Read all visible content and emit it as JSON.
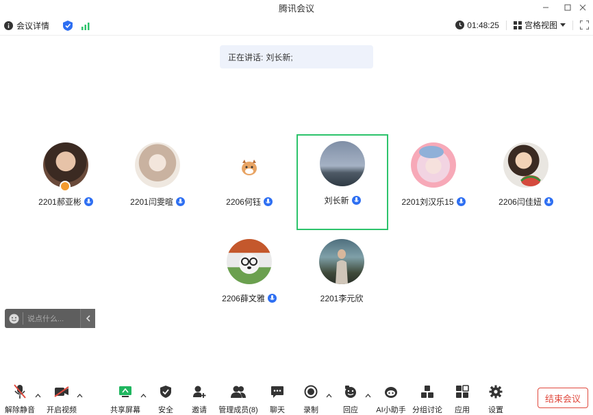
{
  "window": {
    "title": "腾讯会议"
  },
  "infobar": {
    "meeting_info": "会议详情",
    "timer": "01:48:25",
    "view_mode": "宫格视图"
  },
  "speaking": {
    "label": "正在讲话:",
    "names": "刘长新;"
  },
  "participants": [
    {
      "name": "2201郝亚彬"
    },
    {
      "name": "2201闫雯暄"
    },
    {
      "name": "2206何钰"
    },
    {
      "name": "刘长新"
    },
    {
      "name": "2201刘汉乐15"
    },
    {
      "name": "2206闫佳妞"
    },
    {
      "name": "2206薛文雅"
    },
    {
      "name": "2201李元欣"
    }
  ],
  "chat": {
    "placeholder": "说点什么..."
  },
  "toolbar": {
    "unmute": "解除静音",
    "start_video": "开启视频",
    "share_screen": "共享屏幕",
    "security": "安全",
    "invite": "邀请",
    "manage_members": "管理成员(8)",
    "chat": "聊天",
    "record": "录制",
    "reply": "回应",
    "ai_assistant": "AI小助手",
    "breakout": "分组讨论",
    "apps": "应用",
    "settings": "设置",
    "end_meeting": "结束会议"
  },
  "colors": {
    "accent": "#2e6ff2",
    "active_border": "#2cc36b",
    "danger": "#e0483c"
  }
}
